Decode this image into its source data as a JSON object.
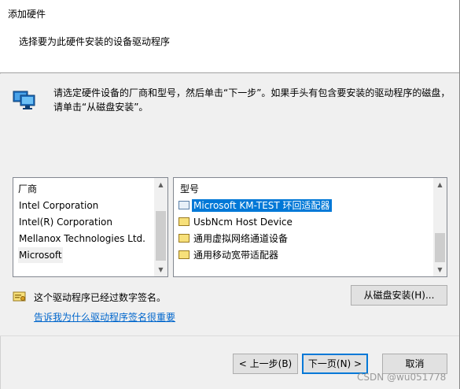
{
  "window": {
    "title": "添加硬件"
  },
  "header": {
    "title": "选择要为此硬件安装的设备驱动程序"
  },
  "instruction": {
    "line1": "请选定硬件设备的厂商和型号，然后单击“下一步”。如果手头有包含要安装的驱动程序的磁盘，",
    "line2": "请单击“从磁盘安装”。"
  },
  "vendor_list": {
    "header": "厂商",
    "items": [
      {
        "label": "Intel Corporation",
        "selected": false
      },
      {
        "label": "Intel(R) Corporation",
        "selected": false
      },
      {
        "label": "Mellanox Technologies Ltd.",
        "selected": false
      },
      {
        "label": "Microsoft",
        "selected": true
      }
    ]
  },
  "model_list": {
    "header": "型号",
    "items": [
      {
        "label": "Microsoft KM-TEST 环回适配器",
        "icon": "network-adapter-icon",
        "selected": true
      },
      {
        "label": "UsbNcm Host Device",
        "icon": "device-driver-icon",
        "selected": false
      },
      {
        "label": "通用虚拟网络通道设备",
        "icon": "device-driver-icon",
        "selected": false
      },
      {
        "label": "通用移动宽带适配器",
        "icon": "device-driver-icon",
        "selected": false
      }
    ]
  },
  "signature": {
    "text": "这个驱动程序已经过数字签名。",
    "link": "告诉我为什么驱动程序签名很重要"
  },
  "buttons": {
    "have_disk": "从磁盘安装(H)...",
    "back": "< 上一步(B)",
    "next": "下一页(N) >",
    "cancel": "取消"
  },
  "watermark": "CSDN @wu051778",
  "colors": {
    "selection": "#0078d7",
    "link": "#0066cc"
  }
}
